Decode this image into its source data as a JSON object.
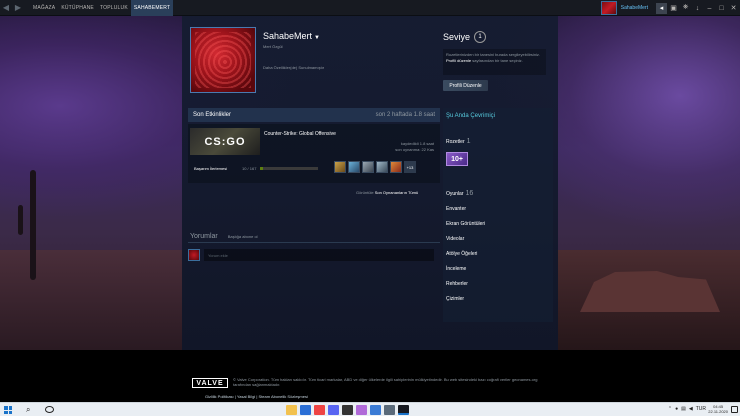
{
  "topbar": {
    "nav": [
      "MAĞAZA",
      "KÜTÜPHANE",
      "TOPLULUK",
      "SAHABEMERT"
    ],
    "active_nav": "SAHABEMERT",
    "user": "SahabeMert"
  },
  "profile": {
    "username": "SahabeMert",
    "realname": "Mert Özgül",
    "summary": "Daha Özellikler(de) Sunulmamıştır",
    "level_title": "Seviye",
    "level": "1",
    "level_text_1": "Rozetlerinizden bir tanesini burada sergileyebilirsiniz.",
    "level_text_bold": "Profili düzenle",
    "level_text_2": "sayfasından bir tane seçiniz.",
    "edit_button": "Profili Düzenle"
  },
  "activity": {
    "title": "Son Etkinlikler",
    "hours": "son 2 haftada 1.8 saat",
    "game_name": "Counter-Strike: Global Offensive",
    "game_logo": "CS:GO",
    "recorded_hours": "kaydedildi 1.8 saat",
    "last_played": "son oynanma: 22 Kas",
    "ach_label": "Başarım İlerlemesi",
    "ach_progress": "10 / 167",
    "ach_fraction": 0.06,
    "ach_more": "+13",
    "recent_prefix": "Görüntüle",
    "recent_bold": "Son Oynananların Tümü"
  },
  "comments": {
    "title": "Yorumlar",
    "subscribe": "Başlığa abone ol",
    "placeholder": "Yorum ekle"
  },
  "sidebar": {
    "online": "Şu Anda Çevrimiçi",
    "badges_label": "Rozetler",
    "badges_count": "1",
    "badge_text": "10+",
    "games_label": "Oyunlar",
    "games_count": "16",
    "links": [
      "Envanter",
      "Ekran Görüntüleri",
      "Videolar",
      "Atölye Öğeleri",
      "İnceleme",
      "Rehberler",
      "Çizimler"
    ]
  },
  "footer": {
    "valve": "VALVE",
    "text": "© Valve Corporation. Tüm hakları saklıdır. Tüm ticari markalar, ABD ve diğer ülkelerde ilgili sahiplerinin mülkiyetindedir. Bu web sitesindeki bazı coğrafi veriler geonames.org tarafından sağlanmaktadır.",
    "links": "Gizlilik Politikası | Yasal Bilgi | Steam Abonelik Sözleşmesi"
  },
  "taskbar": {
    "lang": "TUR",
    "time": "04:45",
    "date": "22.11.2020"
  }
}
